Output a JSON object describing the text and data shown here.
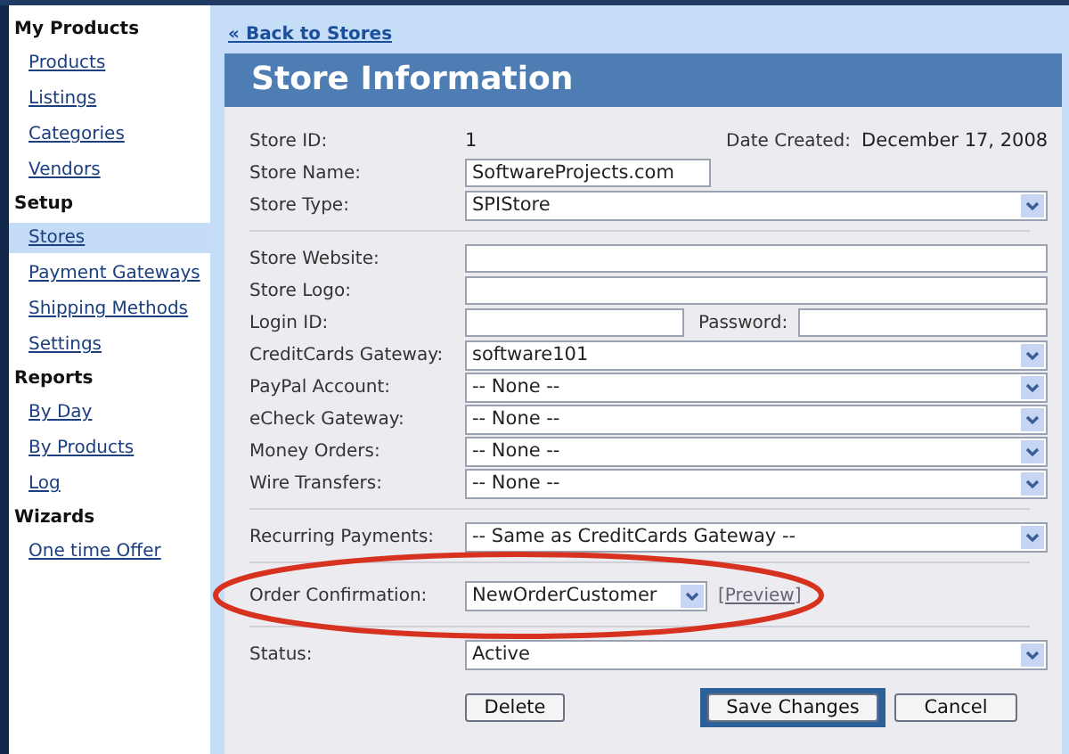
{
  "sidebar": {
    "sections": [
      {
        "title": "My Products",
        "items": [
          {
            "label": "Products",
            "selected": false
          },
          {
            "label": "Listings",
            "selected": false
          },
          {
            "label": "Categories",
            "selected": false
          },
          {
            "label": "Vendors",
            "selected": false
          }
        ]
      },
      {
        "title": "Setup",
        "items": [
          {
            "label": "Stores",
            "selected": true
          },
          {
            "label": "Payment Gateways",
            "selected": false
          },
          {
            "label": "Shipping Methods",
            "selected": false
          },
          {
            "label": "Settings",
            "selected": false
          }
        ]
      },
      {
        "title": "Reports",
        "items": [
          {
            "label": "By Day",
            "selected": false
          },
          {
            "label": "By Products",
            "selected": false
          },
          {
            "label": "Log",
            "selected": false
          }
        ]
      },
      {
        "title": "Wizards",
        "items": [
          {
            "label": "One time Offer",
            "selected": false
          }
        ]
      }
    ]
  },
  "back_link": "« Back to Stores",
  "title": "Store Information",
  "groups": [
    [
      {
        "kind": "info",
        "label": "Store ID:",
        "value": "1",
        "extra_label": "Date Created:",
        "extra_value": "December 17, 2008"
      },
      {
        "kind": "short-text",
        "label": "Store Name:",
        "value": "SoftwareProjects.com"
      },
      {
        "kind": "select",
        "label": "Store Type:",
        "value": "SPIStore"
      }
    ],
    [
      {
        "kind": "text",
        "label": "Store Website:"
      },
      {
        "kind": "text",
        "label": "Store Logo:"
      },
      {
        "kind": "credentials",
        "label": "Login ID:",
        "extra_label": "Password:"
      },
      {
        "kind": "select",
        "label": "CreditCards Gateway:",
        "value": "software101"
      },
      {
        "kind": "select",
        "label": "PayPal Account:",
        "value": "-- None --"
      },
      {
        "kind": "select",
        "label": "eCheck Gateway:",
        "value": "-- None --"
      },
      {
        "kind": "select",
        "label": "Money Orders:",
        "value": "-- None --"
      },
      {
        "kind": "select",
        "label": "Wire Transfers:",
        "value": "-- None --"
      }
    ],
    [
      {
        "kind": "select",
        "label": "Recurring Payments:",
        "value": "-- Same as CreditCards Gateway --"
      }
    ],
    [
      {
        "kind": "select-preview",
        "label": "Order Confirmation:",
        "value": "NewOrderCustomer",
        "link": "[Preview]",
        "highlighted": true
      }
    ],
    [
      {
        "kind": "select",
        "label": "Status:",
        "value": "Active"
      }
    ]
  ],
  "buttons": [
    {
      "label": "Delete",
      "kind": "default"
    },
    {
      "label": "Save Changes",
      "kind": "primary"
    },
    {
      "label": "Cancel",
      "kind": "default"
    }
  ]
}
